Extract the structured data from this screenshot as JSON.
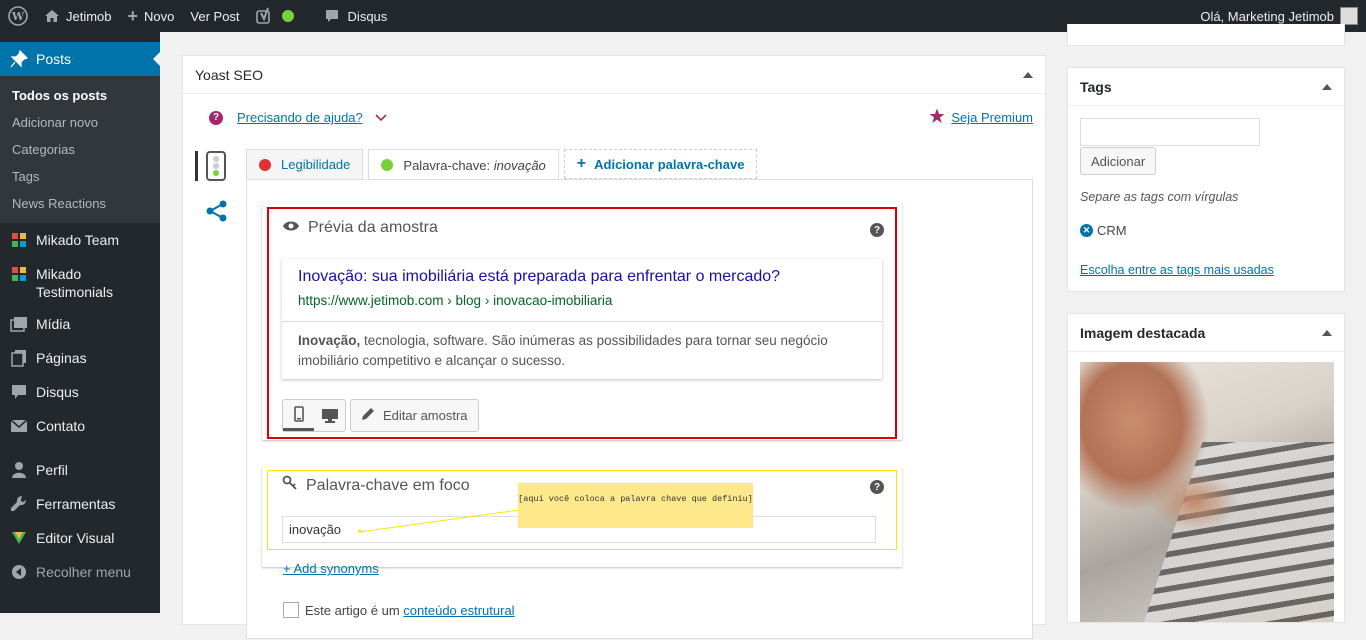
{
  "adminbar": {
    "site_name": "Jetimob",
    "new_label": "Novo",
    "view_post": "Ver Post",
    "disqus": "Disqus",
    "greeting": "Olá, Marketing Jetimob"
  },
  "sidebar": {
    "posts": "Posts",
    "submenu": [
      "Todos os posts",
      "Adicionar novo",
      "Categorias",
      "Tags",
      "News Reactions"
    ],
    "mikado_team": "Mikado Team",
    "mikado_testimonials": "Mikado Testimonials",
    "midia": "Mídia",
    "paginas": "Páginas",
    "disqus": "Disqus",
    "contato": "Contato",
    "perfil": "Perfil",
    "ferramentas": "Ferramentas",
    "editor_visual": "Editor Visual",
    "recolher": "Recolher menu"
  },
  "yoast": {
    "title": "Yoast SEO",
    "help": "Precisando de ajuda?",
    "premium": "Seja Premium",
    "tabs": {
      "legibilidade": "Legibilidade",
      "palavra_prefix": "Palavra-chave: ",
      "palavra_value": "inovação",
      "adicionar": "Adicionar palavra-chave"
    },
    "snippet": {
      "heading": "Prévia da amostra",
      "title": "Inovação: sua imobiliária está preparada para enfrentar o mercado?",
      "url": "https://www.jetimob.com › blog › inovacao-imobiliaria",
      "desc_bold": "Inovação,",
      "desc_rest": " tecnologia, software. São inúmeras as possibilidades para tornar seu negócio imobiliário competitivo e alcançar o sucesso.",
      "edit_button": "Editar amostra"
    },
    "keyword": {
      "heading": "Palavra-chave em foco",
      "value": "inovação",
      "note": "[aqui você coloca a palavra chave que definiu]",
      "synonyms": "+ Add synonyms",
      "cornerstone_prefix": "Este artigo é um ",
      "cornerstone_link": "conteúdo estrutural"
    }
  },
  "tags_box": {
    "title": "Tags",
    "add_button": "Adicionar",
    "hint": "Separe as tags com vírgulas",
    "tag": "CRM",
    "most_used": "Escolha entre as tags mais usadas"
  },
  "featured_box": {
    "title": "Imagem destacada"
  },
  "colors": {
    "adminbar": "#23282d",
    "primary": "#0073aa",
    "yoast_purple": "#a4286a",
    "red_dot": "#dc3232",
    "green_dot": "#7ad03a",
    "highlight_red": "#dd0000",
    "highlight_yellow": "#ffe500",
    "note": "#fde98b"
  }
}
